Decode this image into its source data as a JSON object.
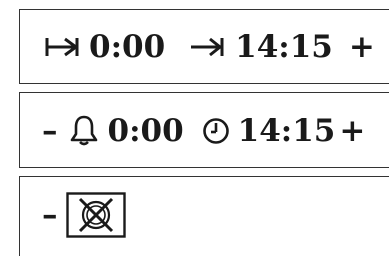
{
  "timer_row": {
    "start_icon": "skip-to-start-icon",
    "start_time": "0:00",
    "end_icon": "arrow-to-end-icon",
    "end_time": "14:15",
    "increase_label": "+"
  },
  "alarm_row": {
    "decrease_label": "–",
    "bell_icon": "bell-icon",
    "bell_time": "0:00",
    "clock_icon": "clock-icon",
    "clock_time": "14:15",
    "increase_label": "+"
  },
  "mute_row": {
    "decrease_label": "–",
    "mute_icon": "muted-speaker-icon"
  }
}
